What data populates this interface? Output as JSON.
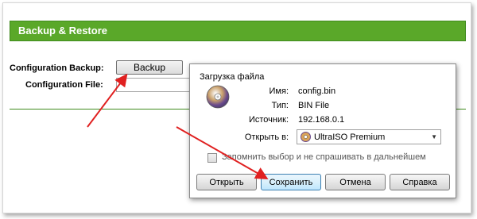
{
  "page": {
    "title": "Backup & Restore",
    "config_backup_label": "Configuration Backup:",
    "backup_button": "Backup",
    "config_file_label": "Configuration File:"
  },
  "dialog": {
    "title": "Загрузка файла",
    "name_key": "Имя:",
    "name_value": "config.bin",
    "type_key": "Тип:",
    "type_value": "BIN File",
    "source_key": "Источник:",
    "source_value": "192.168.0.1",
    "open_with_key": "Открыть в:",
    "open_with_value": "UltraISO Premium",
    "remember_label": "Запомнить выбор и не спрашивать в дальнейшем",
    "remember_checked": false,
    "buttons": {
      "open": "Открыть",
      "save": "Сохранить",
      "cancel": "Отмена",
      "help": "Справка"
    }
  },
  "icons": {
    "file_icon": "disc-icon",
    "app_icon": "ultraiso-icon",
    "dropdown": "chevron-down-icon"
  },
  "colors": {
    "header_green": "#5aa829",
    "arrow_red": "#e02020",
    "default_button": "#bee6fd"
  }
}
